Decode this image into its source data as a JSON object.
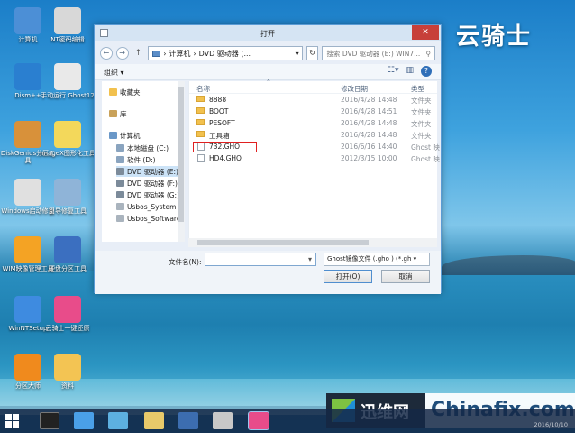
{
  "brand": "云骑士",
  "desktop_icons": [
    {
      "label": "计算机",
      "color": "#4c8fd6"
    },
    {
      "label": "NT密码编辑",
      "color": "#d8d8d8"
    },
    {
      "label": "Dism++",
      "color": "#2a7fd0"
    },
    {
      "label": "手动运行 Ghost12",
      "color": "#e9e9e9"
    },
    {
      "label": "DiskGenius分区工具",
      "color": "#d8913a"
    },
    {
      "label": "ImageX图形化工具",
      "color": "#f3d85b"
    },
    {
      "label": "Windows启动修复",
      "color": "#e0e0e0"
    },
    {
      "label": "引导修复工具",
      "color": "#8fb4d8"
    },
    {
      "label": "WIM映像管理工具",
      "color": "#f4a324"
    },
    {
      "label": "硬盘分区工具",
      "color": "#3b6fc0"
    },
    {
      "label": "WinNTSetup",
      "color": "#3e8be0"
    },
    {
      "label": "云骑士一键还原",
      "color": "#e84c8a"
    },
    {
      "label": "分区大师",
      "color": "#f08a1d"
    },
    {
      "label": "资料",
      "color": "#f3c453"
    }
  ],
  "dialog": {
    "title": "打开",
    "address": {
      "computer": "计算机",
      "drive": "DVD 驱动器 (..."
    },
    "search_placeholder": "搜索 DVD 驱动器 (E:) WIN7...",
    "organize": "组织 ▾",
    "nav": [
      {
        "label": "收藏夹",
        "color": "#f2c14e"
      },
      {
        "label": "库",
        "color": "#c9a25a"
      },
      {
        "label": "计算机",
        "color": "#6a98c8"
      },
      {
        "label": "本地磁盘 (C:)",
        "color": "#8aa4bf"
      },
      {
        "label": "软件 (D:)",
        "color": "#8aa4bf"
      },
      {
        "label": "DVD 驱动器 (E:)",
        "color": "#7c8b9a"
      },
      {
        "label": "DVD 驱动器 (F:)",
        "color": "#7c8b9a"
      },
      {
        "label": "DVD 驱动器 (G:)",
        "color": "#7c8b9a"
      },
      {
        "label": "Usbos_System (",
        "color": "#aab4be"
      },
      {
        "label": "Usbos_Software",
        "color": "#aab4be"
      }
    ],
    "columns": {
      "name": "名称",
      "date": "修改日期",
      "type": "类型"
    },
    "files": [
      {
        "name": "8888",
        "date": "2016/4/28 14:48",
        "type": "文件夹",
        "kind": "folder"
      },
      {
        "name": "BOOT",
        "date": "2016/4/28 14:51",
        "type": "文件夹",
        "kind": "folder"
      },
      {
        "name": "PESOFT",
        "date": "2016/4/28 14:48",
        "type": "文件夹",
        "kind": "folder"
      },
      {
        "name": "工具箱",
        "date": "2016/4/28 14:48",
        "type": "文件夹",
        "kind": "folder"
      },
      {
        "name": "732.GHO",
        "date": "2016/6/16 14:40",
        "type": "Ghost 映",
        "kind": "file"
      },
      {
        "name": "HD4.GHO",
        "date": "2012/3/15 10:00",
        "type": "Ghost 映",
        "kind": "file"
      }
    ],
    "filename_label": "文件名(N):",
    "filename_value": "▾",
    "filetype": "Ghost镜像文件 (.gho ) (*.gh ▾",
    "open_button": "打开(O)",
    "cancel_button": "取消"
  },
  "watermark": {
    "cn": "迅维网",
    "en": "Chinafix.com"
  },
  "taskbar_date": "2016/10/10"
}
